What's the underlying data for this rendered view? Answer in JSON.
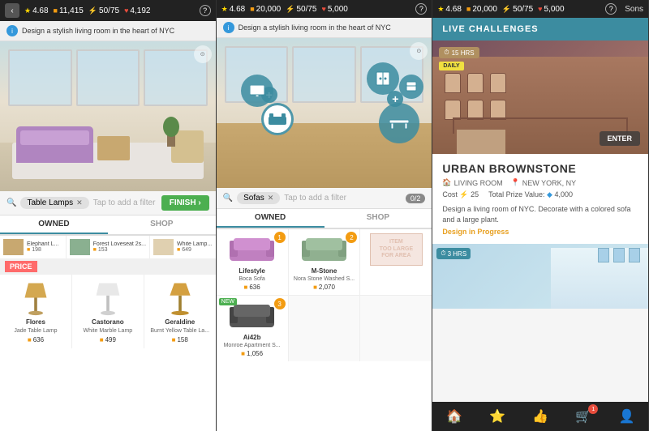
{
  "panels": [
    {
      "id": "panel1",
      "topbar": {
        "stars": "4.68",
        "coins": "11,415",
        "energy": "50/75",
        "hearts": "4,192",
        "has_back": true
      },
      "prompt": "Design a stylish living room in the heart of NYC",
      "search_tag": "Table Lamps",
      "filter_placeholder": "Tap to add a filter",
      "finish_label": "FINISH ›",
      "tabs": [
        "OWNED",
        "SHOP"
      ],
      "active_tab": "OWNED",
      "owned_items": [
        {
          "name": "Elephant L...",
          "price": "198"
        },
        {
          "name": "Forest Loveseat 2s...",
          "price": "153"
        },
        {
          "name": "White Lamp...",
          "price": "649"
        }
      ],
      "shop_label": "SHOP",
      "shop_items": [
        {
          "name": "Flores",
          "subname": "Jade Table Lamp",
          "price": "636",
          "price_type": "coin"
        },
        {
          "name": "Castorano",
          "subname": "White Marble Lamp",
          "price": "499",
          "price_type": "coin"
        },
        {
          "name": "Geraldine",
          "subname": "Burnt Yellow Table La...",
          "price": "158",
          "price_type": "coin"
        }
      ]
    },
    {
      "id": "panel2",
      "topbar": {
        "stars": "4.68",
        "coins": "20,000",
        "energy": "50/75",
        "hearts": "5,000"
      },
      "prompt": "Design a stylish living room in the heart of NYC",
      "search_tag": "Sofas",
      "filter_placeholder": "Tap to add a filter",
      "count": "0/2",
      "tabs": [
        "OWNED",
        "SHOP"
      ],
      "active_tab": "OWNED",
      "owned_items": [
        {
          "name": "Lifestyle",
          "subname": "Boca Sofa",
          "price": "636",
          "badge": "1"
        },
        {
          "name": "M-Stone",
          "subname": "Nora Stone Washed S...",
          "price": "2,070",
          "badge": "2"
        },
        {
          "name": "",
          "subname": "",
          "too_large": true
        },
        {
          "name": "Ai42b",
          "subname": "Monroe Apartment S...",
          "price": "1,056",
          "badge": "3",
          "new": true
        },
        {
          "name": "",
          "subname": "",
          "price": ""
        },
        {
          "name": "",
          "subname": "",
          "price": ""
        }
      ]
    },
    {
      "id": "panel3",
      "topbar": {
        "stars": "4.68",
        "coins": "20,000",
        "energy": "50/75",
        "hearts": "5,000"
      },
      "header": "LIVE CHALLENGES",
      "challenge1": {
        "timer": "15 HRS",
        "daily_label": "DAILY",
        "title": "URBAN BROWNSTONE",
        "room_type": "LIVING ROOM",
        "location": "NEW YORK, NY",
        "cost_label": "Cost",
        "cost_value": "25",
        "prize_label": "Total Prize Value:",
        "prize_value": "4,000",
        "description": "Design a living room of NYC. Decorate with a colored sofa and a large plant.",
        "progress_label": "Design in Progress",
        "enter_label": "ENTER"
      },
      "challenge2": {
        "timer": "3 HRS"
      },
      "nav_items": [
        "🏠",
        "⭐",
        "👍",
        "🛒",
        "👤"
      ],
      "sons_text": "Sons"
    }
  ]
}
